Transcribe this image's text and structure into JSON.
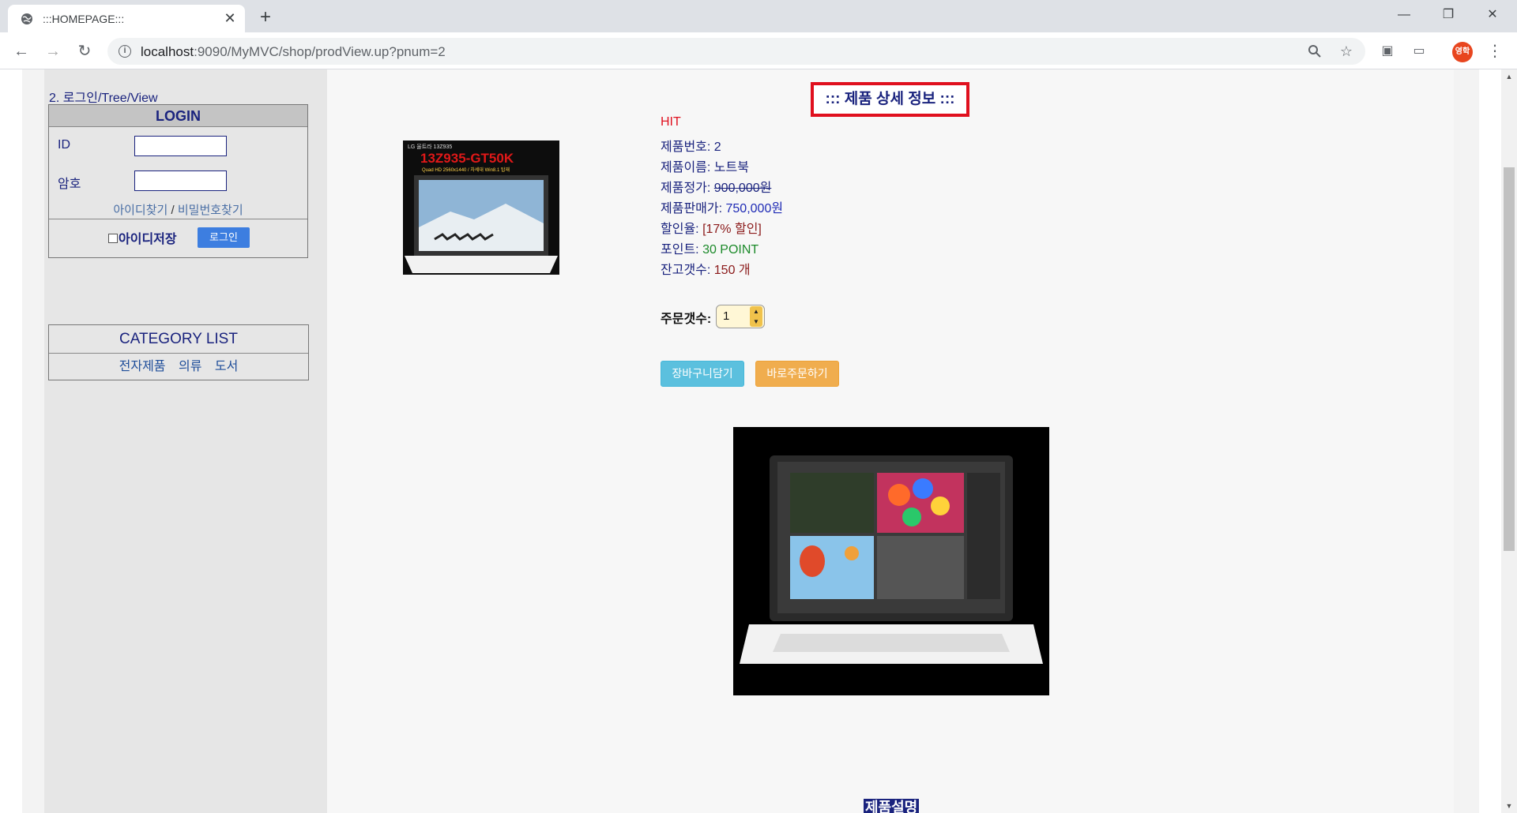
{
  "browser": {
    "tab_title": ":::HOMEPAGE:::",
    "tab_close": "✕",
    "new_tab": "+",
    "url_host": "localhost",
    "url_path": ":9090/MyMVC/shop/prodView.up?pnum=2",
    "profile_initials": "영학",
    "window_controls": {
      "minimize": "—",
      "restore": "❐",
      "close": "✕"
    }
  },
  "sidebar": {
    "login_caption": "2. 로그인/Tree/View",
    "login": {
      "header": "LOGIN",
      "id_label": "ID",
      "pw_label": "암호",
      "find_id": "아이디찾기",
      "separator": "/",
      "find_pw": "비밀번호찾기",
      "save_id_label": "아이디저장",
      "login_button": "로그인"
    },
    "category": {
      "header": "CATEGORY LIST",
      "items": [
        "전자제품",
        "의류",
        "도서"
      ]
    }
  },
  "content": {
    "title": "::: 제품 상세 정보 :::",
    "thumbnail": {
      "brand_text": "LG 울트라 13Z935",
      "model_text": "13Z935-GT50K",
      "spec_text": "Quad HD 2560x1440 / 차세대 Win8.1 탑재"
    },
    "info": {
      "spec_badge": "HIT",
      "pnum_label": "제품번호:",
      "pnum_value": "2",
      "name_label": "제품이름:",
      "name_value": "노트북",
      "price_label": "제품정가:",
      "price_value": "900,000원",
      "saleprice_label": "제품판매가:",
      "saleprice_value": "750,000원",
      "discount_label": "할인율:",
      "discount_value": "[17% 할인]",
      "point_label": "포인트:",
      "point_value": "30 POINT",
      "stock_label": "잔고갯수:",
      "stock_value": "150 개"
    },
    "order": {
      "qty_label": "주문갯수:",
      "qty_value": "1",
      "cart_button": "장바구니담기",
      "order_button": "바로주문하기"
    },
    "desc_label": "제품설명"
  },
  "colors": {
    "title_border": "#e0101e",
    "navy_text": "#1a237e",
    "cart_button": "#5bc0de",
    "order_button": "#f0ad4e",
    "login_button": "#3d7ee0"
  },
  "icons": [
    "globe-icon",
    "back-arrow-icon",
    "forward-arrow-icon",
    "reload-icon",
    "info-icon",
    "zoom-icon",
    "star-icon",
    "extension-icon",
    "cast-icon",
    "menu-icon"
  ]
}
